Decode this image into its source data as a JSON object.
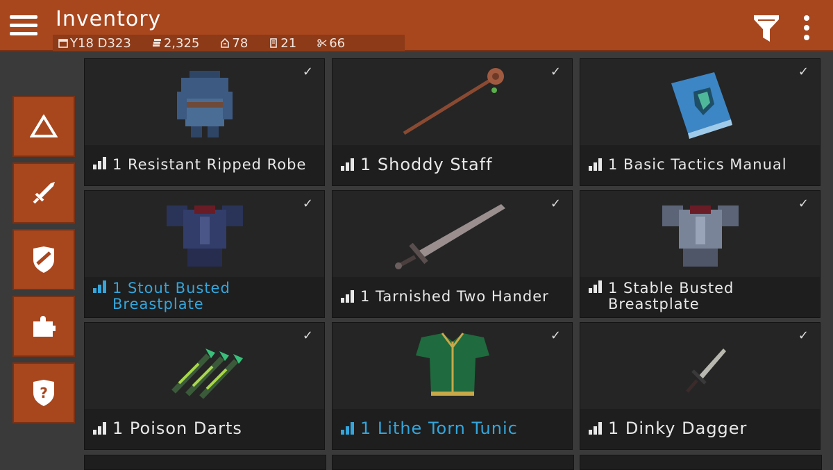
{
  "header": {
    "title": "Inventory",
    "stats": [
      {
        "icon": "calendar-icon",
        "value": "Y18 D323"
      },
      {
        "icon": "coins-icon",
        "value": "2,325"
      },
      {
        "icon": "supplies-icon",
        "value": "78"
      },
      {
        "icon": "scroll-icon",
        "value": "21"
      },
      {
        "icon": "scissors-icon",
        "value": "66"
      }
    ],
    "menu_icon": "hamburger-icon",
    "filter_icon": "filter-icon",
    "more_icon": "more-vertical-icon"
  },
  "sidebar": {
    "tabs": [
      {
        "icon": "triangle-icon"
      },
      {
        "icon": "sword-icon"
      },
      {
        "icon": "shield-icon"
      },
      {
        "icon": "puzzle-icon"
      },
      {
        "icon": "question-shield-icon"
      }
    ]
  },
  "items": [
    {
      "label": "1 Resistant Ripped Robe",
      "quality": "gray",
      "icon": "robe-icon"
    },
    {
      "label": "1 Shoddy Staff",
      "quality": "gray",
      "icon": "staff-icon"
    },
    {
      "label": "1 Basic Tactics Manual",
      "quality": "gray",
      "icon": "book-icon"
    },
    {
      "label": "1 Stout Busted Breastplate",
      "quality": "blue",
      "icon": "breastplate-icon"
    },
    {
      "label": "1 Tarnished Two Hander",
      "quality": "gray",
      "icon": "greatsword-icon"
    },
    {
      "label": "1 Stable Busted Breastplate",
      "quality": "gray",
      "icon": "breastplate-icon"
    },
    {
      "label": "1 Poison Darts",
      "quality": "gray",
      "icon": "darts-icon"
    },
    {
      "label": "1 Lithe Torn Tunic",
      "quality": "blue",
      "icon": "tunic-icon"
    },
    {
      "label": "1 Dinky Dagger",
      "quality": "gray",
      "icon": "dagger-icon"
    }
  ],
  "colors": {
    "header": "#a8461e",
    "accent_blue": "#34a6dc",
    "text": "#e8e8e8"
  },
  "check_glyph": "✓"
}
